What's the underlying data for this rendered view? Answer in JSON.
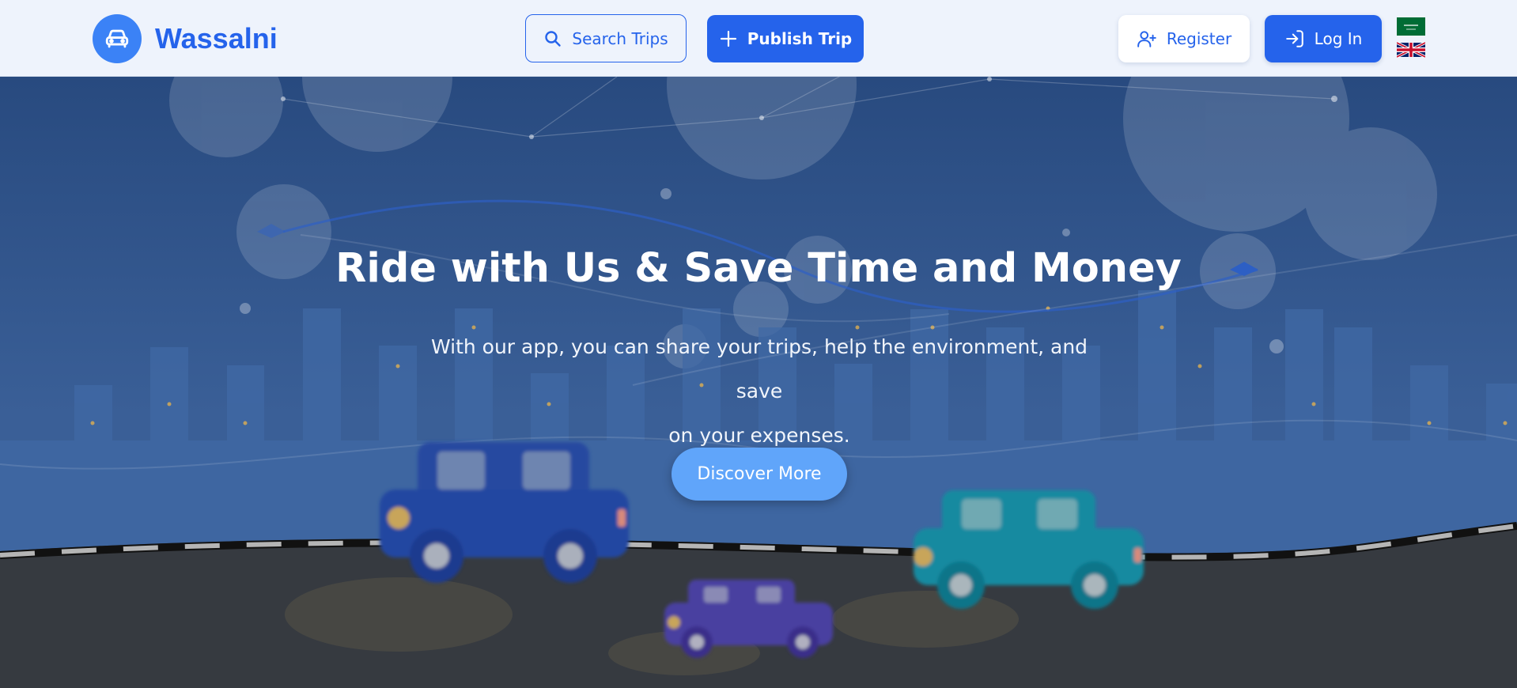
{
  "brand": {
    "name": "Wassalni",
    "icon": "car-icon"
  },
  "nav": {
    "search_label": "Search Trips",
    "publish_label": "Publish Trip",
    "register_label": "Register",
    "login_label": "Log In"
  },
  "languages": [
    "Arabic",
    "English"
  ],
  "hero": {
    "title": "Ride with Us & Save Time and Money",
    "subtitle_line1": "With our app, you can share your trips, help the environment, and save",
    "subtitle_line2": "on your expenses.",
    "cta_label": "Discover More"
  },
  "colors": {
    "primary": "#2563eb",
    "accent": "#60a5fa",
    "header_bg": "#eef3fc"
  }
}
